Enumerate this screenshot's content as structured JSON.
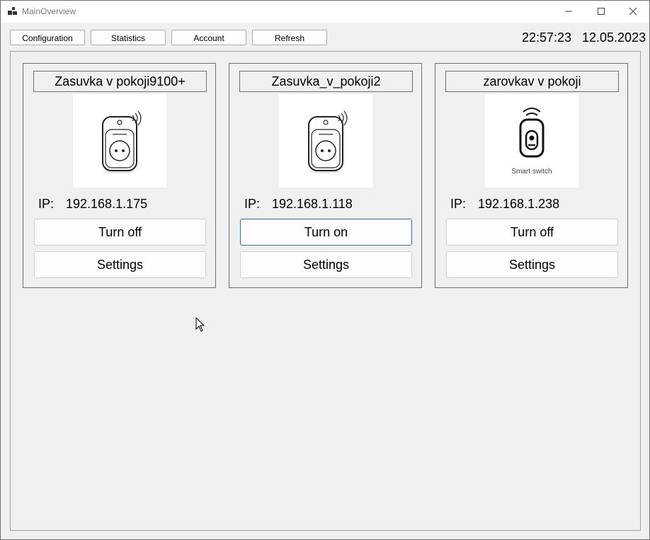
{
  "window": {
    "title": "MainOverview"
  },
  "toolbar": {
    "configuration_label": "Configuration",
    "statistics_label": "Statistics",
    "account_label": "Account",
    "refresh_label": "Refresh"
  },
  "clock": {
    "time": "22:57:23",
    "date": "12.05.2023"
  },
  "devices": [
    {
      "name": "Zasuvka v pokoji9100+",
      "ip_label": "IP:",
      "ip": "192.168.1.175",
      "toggle_label": "Turn off",
      "settings_label": "Settings",
      "icon": "smart-plug-icon",
      "image_caption": ""
    },
    {
      "name": "Zasuvka_v_pokoji2",
      "ip_label": "IP:",
      "ip": "192.168.1.118",
      "toggle_label": "Turn on",
      "settings_label": "Settings",
      "icon": "smart-plug-icon",
      "image_caption": ""
    },
    {
      "name": "zarovkav v pokoji",
      "ip_label": "IP:",
      "ip": "192.168.1.238",
      "toggle_label": "Turn off",
      "settings_label": "Settings",
      "icon": "smart-switch-icon",
      "image_caption": "Smart switch"
    }
  ],
  "colors": {
    "background": "#f0f0f0",
    "focus_border": "#2a6fbf",
    "border": "#6e6e6e"
  }
}
